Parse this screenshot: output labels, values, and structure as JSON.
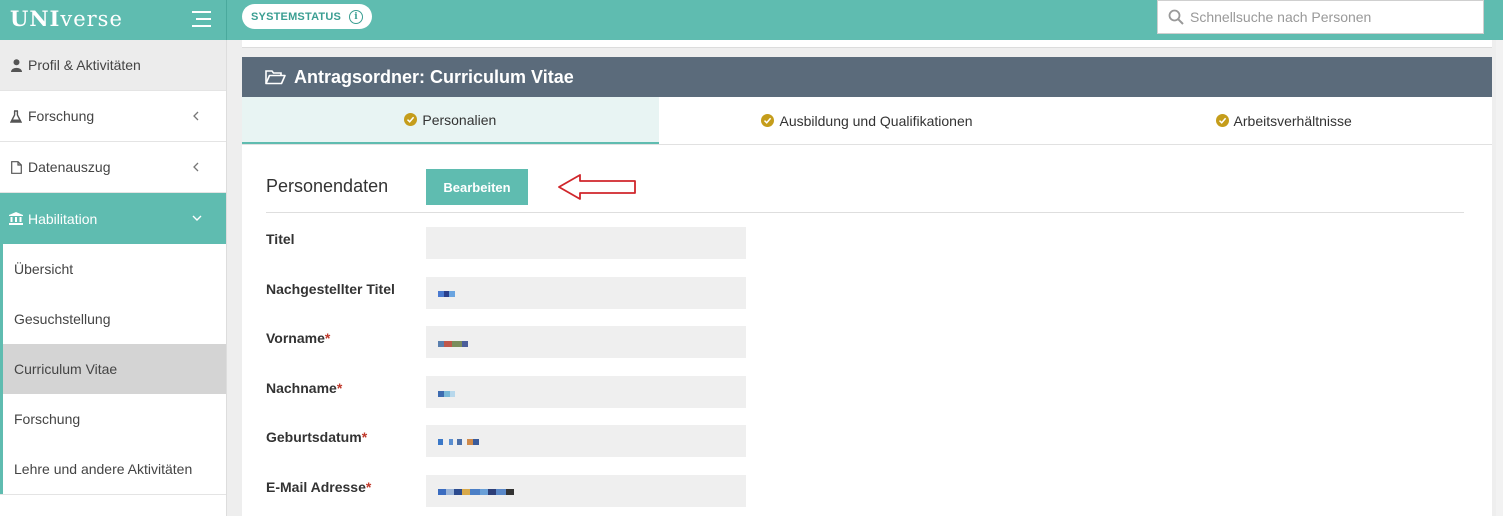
{
  "app": {
    "brand_bold": "UNI",
    "brand_rest": "verse",
    "system_status": "SYSTEMSTATUS",
    "search_placeholder": "Schnellsuche nach Personen"
  },
  "sidebar": {
    "items": [
      {
        "label": "Profil & Aktivitäten",
        "icon": "user-icon"
      },
      {
        "label": "Forschung",
        "icon": "flask-icon"
      },
      {
        "label": "Datenauszug",
        "icon": "document-icon"
      },
      {
        "label": "Habilitation",
        "icon": "institution-icon"
      }
    ],
    "subitems": [
      {
        "label": "Übersicht"
      },
      {
        "label": "Gesuchstellung"
      },
      {
        "label": "Curriculum Vitae",
        "selected": true
      },
      {
        "label": "Forschung"
      },
      {
        "label": "Lehre und andere Aktivitäten"
      }
    ]
  },
  "panel": {
    "title": "Antragsordner: Curriculum Vitae",
    "tabs": [
      {
        "label": "Personalien",
        "active": true
      },
      {
        "label": "Ausbildung und Qualifikationen"
      },
      {
        "label": "Arbeitsverhältnisse"
      }
    ]
  },
  "section": {
    "title": "Personendaten",
    "edit_button": "Bearbeiten"
  },
  "fields": [
    {
      "label": "Titel",
      "required": false
    },
    {
      "label": "Nachgestellter Titel",
      "required": false
    },
    {
      "label": "Vorname",
      "required": true
    },
    {
      "label": "Nachname",
      "required": true
    },
    {
      "label": "Geburtsdatum",
      "required": true
    },
    {
      "label": "E-Mail Adresse",
      "required": true
    }
  ],
  "colors": {
    "accent": "#5fbcb0",
    "header": "#5b6b7b",
    "check": "#c59d1b",
    "required": "#c0392b",
    "annotation_arrow": "#d0262b"
  }
}
